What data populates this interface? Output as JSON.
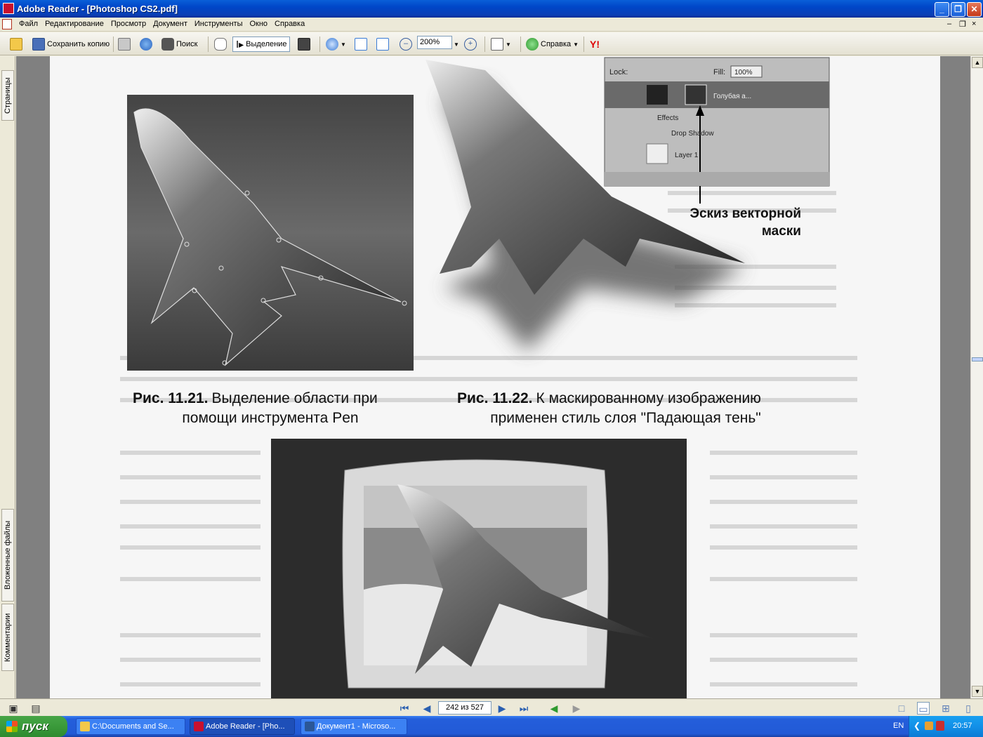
{
  "window": {
    "title": "Adobe Reader - [Photoshop CS2.pdf]",
    "controls": {
      "minimize": "_",
      "maximize": "❐",
      "close": "✕"
    }
  },
  "menu": {
    "items": [
      "Файл",
      "Редактирование",
      "Просмотр",
      "Документ",
      "Инструменты",
      "Окно",
      "Справка"
    ],
    "doc_controls": {
      "minimize": "–",
      "restore": "❐",
      "close": "×"
    }
  },
  "toolbar": {
    "save_copy": "Сохранить копию",
    "search": "Поиск",
    "select": "Выделение",
    "zoom": "200%",
    "help": "Справка"
  },
  "nav_tabs": {
    "pages": "Страницы",
    "attachments": "Вложенные файлы",
    "comments": "Комментарии"
  },
  "document": {
    "ps_panel": {
      "lock_label": "Lock:",
      "fill_label": "Fill:",
      "fill_value": "100%",
      "layer_name": "Голубая а...",
      "effects": "Effects",
      "drop_shadow": "Drop Shadow",
      "layer1": "Layer 1"
    },
    "annotation": [
      "Эскиз векторной",
      "маски"
    ],
    "caption_left": {
      "number": "Рис. 11.21.",
      "line1": "Выделение области при",
      "line2": "помощи инструмента Pen"
    },
    "caption_right": {
      "number": "Рис. 11.22.",
      "line1": "К маскированному изображению",
      "line2": "применен стиль слоя \"Падающая тень\""
    }
  },
  "statusbar": {
    "page_indicator": "242 из 527"
  },
  "taskbar": {
    "start": "пуск",
    "tasks": [
      "C:\\Documents and Se...",
      "Adobe Reader - [Pho...",
      "Документ1 - Microso..."
    ],
    "language": "EN",
    "clock": "20:57"
  }
}
